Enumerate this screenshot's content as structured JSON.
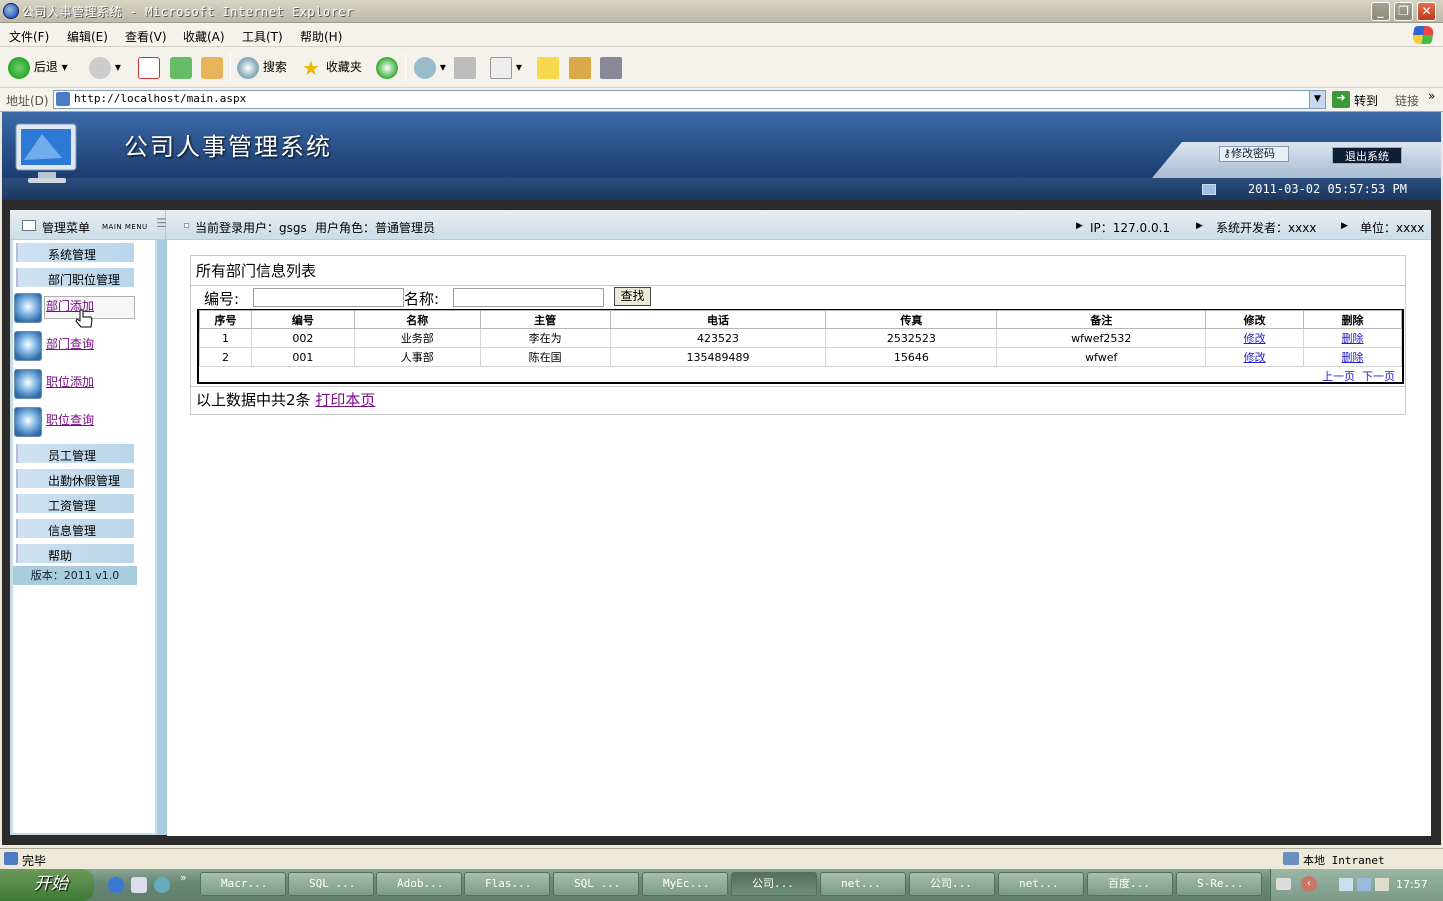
{
  "window": {
    "title": "公司人事管理系统 - Microsoft Internet Explorer"
  },
  "menu": [
    "文件(F)",
    "编辑(E)",
    "查看(V)",
    "收藏(A)",
    "工具(T)",
    "帮助(H)"
  ],
  "toolbar": {
    "back": "后退",
    "search": "搜索",
    "favorites": "收藏夹"
  },
  "address": {
    "label": "地址(D)",
    "url": "http://localhost/main.aspx",
    "go": "转到",
    "links": "链接"
  },
  "app": {
    "title": "公司人事管理系统",
    "change_password": "修改密码",
    "exit": "退出系统",
    "datetime": "2011-03-02 05:57:53 PM"
  },
  "sidebar": {
    "header": "管理菜单",
    "header_en": "MAIN MENU",
    "items": [
      "系统管理",
      "部门职位管理"
    ],
    "subitems": [
      "部门添加",
      "部门查询",
      "职位添加",
      "职位查询"
    ],
    "items2": [
      "员工管理",
      "出勤休假管理",
      "工资管理",
      "信息管理",
      "帮助"
    ],
    "version": "版本：2011  v1.0"
  },
  "infobar": {
    "user": "当前登录用户：gsgs",
    "role": "用户角色：普通管理员",
    "ip": "IP：127.0.0.1",
    "developer": "系统开发者：xxxx",
    "unit": "单位：xxxx"
  },
  "panel": {
    "title": "所有部门信息列表",
    "code_label": "编号:",
    "name_label": "名称:",
    "find": "查找",
    "columns": [
      "序号",
      "编号",
      "名称",
      "主管",
      "电话",
      "传真",
      "备注",
      "修改",
      "删除"
    ],
    "rows": [
      [
        "1",
        "002",
        "业务部",
        "李在为",
        "423523",
        "2532523",
        "wfwef2532",
        "修改",
        "删除"
      ],
      [
        "2",
        "001",
        "人事部",
        "陈在国",
        "135489489",
        "15646",
        "wfwef",
        "修改",
        "删除"
      ]
    ],
    "prev": "上一页",
    "next": "下一页",
    "summary": "以上数据中共2条",
    "print": "打印本页"
  },
  "status": {
    "text": "完毕",
    "zone": "本地 Intranet"
  },
  "taskbar": {
    "start": "开始",
    "tasks": [
      "Macr...",
      "SQL ...",
      "Adob...",
      "Flas...",
      "SQL ...",
      "MyEc...",
      "公司...",
      "net...",
      "公司...",
      "net...",
      "百度...",
      "S-Re..."
    ],
    "clock": "17:57"
  }
}
